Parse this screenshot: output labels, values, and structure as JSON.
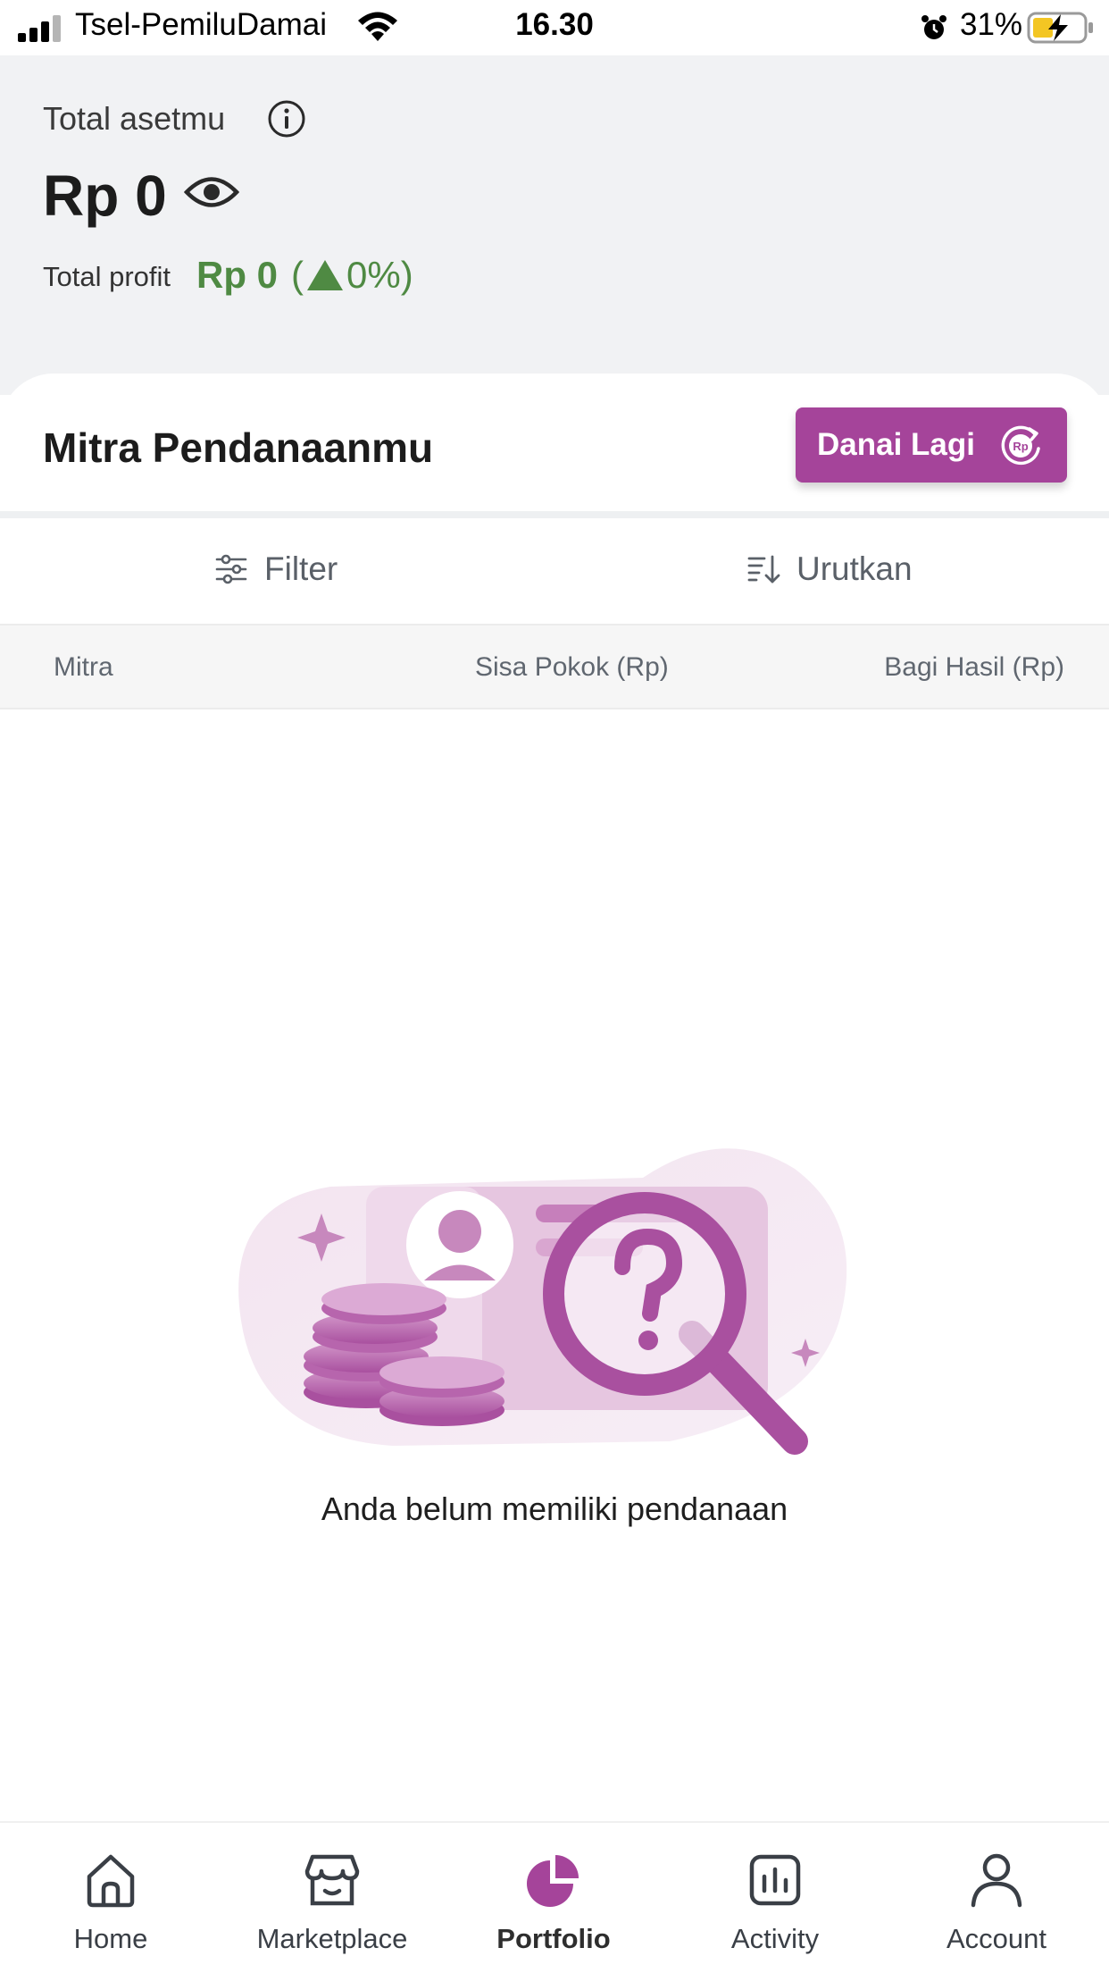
{
  "status_bar": {
    "carrier": "Tsel-PemiluDamai",
    "time": "16.30",
    "battery_percent": "31%",
    "icons": [
      "signal-icon",
      "wifi-icon",
      "alarm-icon",
      "battery-charging-icon"
    ]
  },
  "header": {
    "total_label": "Total asetmu",
    "total_value": "Rp 0",
    "profit_label": "Total profit",
    "profit_value": "Rp 0",
    "profit_pct_open": "(",
    "profit_pct_value": "0%)",
    "icons": [
      "info-icon",
      "eye-icon",
      "triangle-up-icon"
    ]
  },
  "section": {
    "title": "Mitra Pendanaanmu",
    "fund_again_label": "Danai Lagi",
    "rp_icon_text": "Rp"
  },
  "toolbar": {
    "filter_label": "Filter",
    "sort_label": "Urutkan",
    "icons": [
      "filter-sliders-icon",
      "sort-icon"
    ]
  },
  "table": {
    "columns": [
      "Mitra",
      "Sisa Pokok (Rp)",
      "Bagi Hasil (Rp)"
    ],
    "rows": []
  },
  "empty_state": {
    "message": "Anda belum memiliki pendanaan",
    "illustration": "empty-search-illustration"
  },
  "bottom_nav": {
    "items": [
      {
        "label": "Home",
        "icon": "home-icon"
      },
      {
        "label": "Marketplace",
        "icon": "store-icon"
      },
      {
        "label": "Portfolio",
        "icon": "pie-chart-icon",
        "active": true
      },
      {
        "label": "Activity",
        "icon": "activity-chart-icon"
      },
      {
        "label": "Account",
        "icon": "user-icon"
      }
    ]
  },
  "colors": {
    "brand": "#a5449a",
    "profit_green": "#4f8a43",
    "header_bg": "#f1f2f4"
  }
}
